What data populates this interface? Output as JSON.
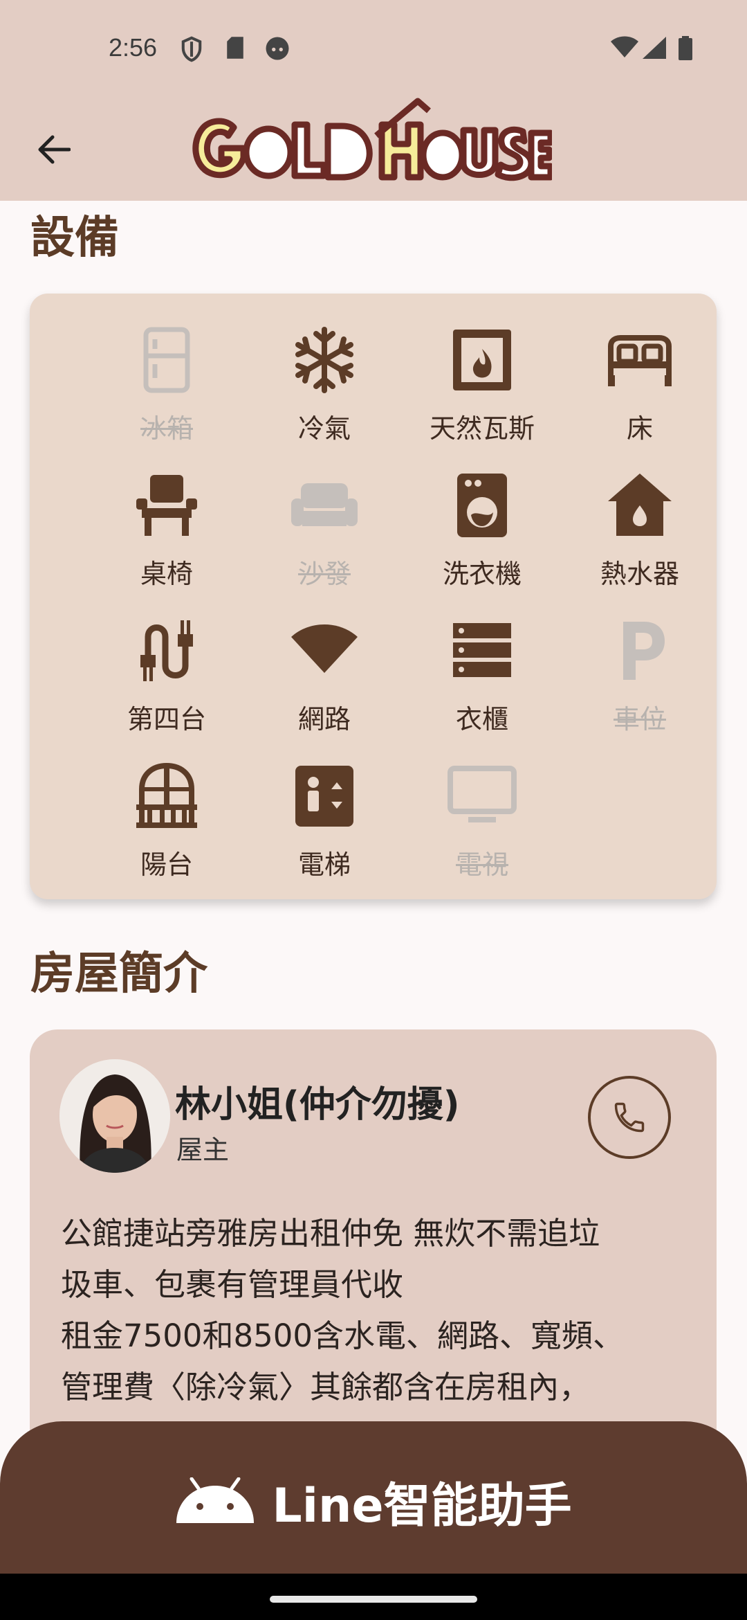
{
  "status_bar": {
    "time": "2:56",
    "left_icons": [
      "shield-icon",
      "sd-card-icon",
      "face-icon"
    ],
    "right_icons": [
      "wifi-icon",
      "signal-icon",
      "battery-icon"
    ]
  },
  "app_bar": {
    "logo_text": "GOLD HOUSE",
    "back_icon": "arrow-back-icon"
  },
  "equipment": {
    "title": "設備",
    "items": [
      {
        "label": "冰箱",
        "icon": "fridge-icon",
        "available": false
      },
      {
        "label": "冷氣",
        "icon": "snowflake-icon",
        "available": true
      },
      {
        "label": "天然瓦斯",
        "icon": "gas-fireplace-icon",
        "available": true
      },
      {
        "label": "床",
        "icon": "bed-icon",
        "available": true
      },
      {
        "label": "桌椅",
        "icon": "chair-icon",
        "available": true
      },
      {
        "label": "沙發",
        "icon": "sofa-icon",
        "available": false
      },
      {
        "label": "洗衣機",
        "icon": "washing-machine-icon",
        "available": true
      },
      {
        "label": "熱水器",
        "icon": "water-heater-icon",
        "available": true
      },
      {
        "label": "第四台",
        "icon": "cable-icon",
        "available": true
      },
      {
        "label": "網路",
        "icon": "wifi-icon",
        "available": true
      },
      {
        "label": "衣櫃",
        "icon": "wardrobe-icon",
        "available": true
      },
      {
        "label": "車位",
        "icon": "parking-icon",
        "available": false
      },
      {
        "label": "陽台",
        "icon": "balcony-icon",
        "available": true
      },
      {
        "label": "電梯",
        "icon": "elevator-icon",
        "available": true
      },
      {
        "label": "電視",
        "icon": "tv-icon",
        "available": false
      }
    ]
  },
  "intro": {
    "title": "房屋簡介",
    "owner_name": "林小姐(仲介勿擾)",
    "owner_role": "屋主",
    "description": "公館捷站旁雅房出租仲免 無炊不需追垃\n圾車、包裹有管理員代收\n租金7500和8500含水電、網路、寬頻、\n管理費〈除冷氣〉其餘都含在房租內，"
  },
  "line_assistant": {
    "label": "Line智能助手",
    "icon": "android-icon"
  },
  "colors": {
    "header_bg": "#E3CDC4",
    "card_bg": "#EAD8CB",
    "icon_brown": "#5C3C27",
    "icon_disabled": "#BDB7B3",
    "button_brown": "#5E3C2F"
  }
}
